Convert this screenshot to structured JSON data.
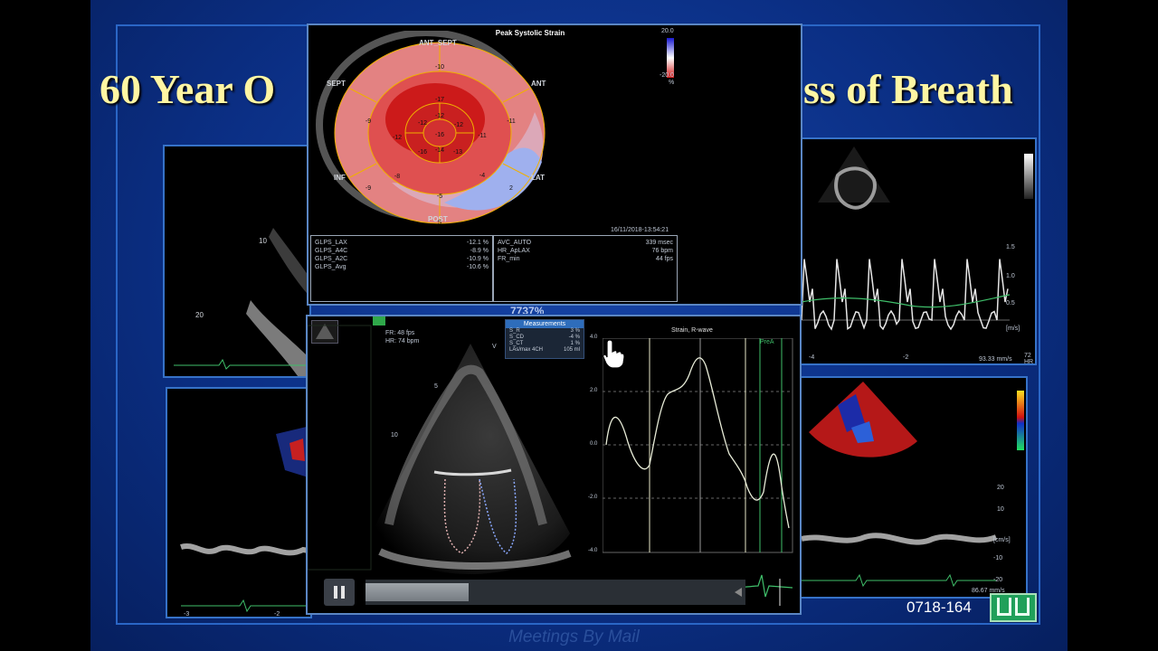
{
  "slide": {
    "title_left": "60 Year O",
    "title_right": "ss of Breath",
    "case_number": "0718-164",
    "watermark": "Meetings By Mail",
    "obscured_value": "7737%"
  },
  "bullseye": {
    "heading": "Peak Systolic Strain",
    "labels": {
      "ant_sept": "ANT_SEPT",
      "ant": "ANT",
      "sept": "SEPT",
      "inf": "INF",
      "lat": "LAT",
      "post": "POST"
    },
    "scale": {
      "max": "20.0",
      "min": "-20.0",
      "unit": "%"
    },
    "timestamp": "16/11/2018-13:54:21",
    "segment_values": [
      "-10",
      "-9",
      "-11",
      "-11",
      "2",
      "5",
      "-5",
      "-9",
      "-12",
      "-17",
      "-12",
      "-8",
      "-16",
      "-13",
      "-4",
      "-12",
      "-16",
      "-12",
      "-14"
    ],
    "stats_left": [
      {
        "label": "GLPS_LAX",
        "value": "-12.1 %"
      },
      {
        "label": "GLPS_A4C",
        "value": "-8.9 %"
      },
      {
        "label": "GLPS_A2C",
        "value": "-10.9 %"
      },
      {
        "label": "GLPS_Avg",
        "value": "-10.6 %"
      }
    ],
    "stats_right": [
      {
        "label": "AVC_AUTO",
        "value": "339 msec"
      },
      {
        "label": "HR_ApLAX",
        "value": "76 bpm"
      },
      {
        "label": "FR_min",
        "value": "44 fps"
      }
    ]
  },
  "echo": {
    "fr": "FR: 48 fps",
    "hr": "HR: 74 bpm",
    "apex_label": "V",
    "depth_marks": [
      "5",
      "10"
    ],
    "measurements": {
      "title": "Measurements",
      "rows": [
        {
          "label": "S_R",
          "value": "3 %"
        },
        {
          "label": "S_CD",
          "value": "-4 %"
        },
        {
          "label": "S_CT",
          "value": "1 %"
        },
        {
          "label": "LAs/max 4CH",
          "value": "105 ml"
        }
      ]
    }
  },
  "strain_plot": {
    "title": "Strain, R-wave",
    "marker": "PreA",
    "y_ticks": [
      "4.0",
      "2.0",
      "0.0",
      "-2.0",
      "-4.0"
    ]
  },
  "doppler_top": {
    "ticks": [
      "1.5",
      "1.0",
      "0.5"
    ],
    "unit": "[m/s]",
    "x_ticks": [
      "-4",
      "-2"
    ],
    "footer": "93.33 mm/s",
    "hr": "72 HR"
  },
  "doppler_bottom": {
    "ticks": [
      "20",
      "10",
      "-10",
      "-20"
    ],
    "unit": "[cm/s]",
    "footer": "86.67 mm/s",
    "hr": "72 HR"
  },
  "left_top_panel": {
    "depth_marks": [
      "10",
      "20"
    ]
  },
  "left_bottom_panel": {
    "x_ticks": [
      "-3",
      "-2"
    ]
  },
  "icons": {
    "pause": "pause-icon",
    "cursor": "hand-pointer-icon",
    "logo": "meetings-logo-icon",
    "thumbnail": "loop-thumbnail-icon"
  },
  "colors": {
    "slide_bg": "#0b2f85",
    "title": "#fff6a3",
    "panel_border": "#3672c8",
    "strain_negative": "#e02020",
    "strain_positive": "#8fa0e8",
    "trace": "#e8ecd8",
    "ecg": "#3fbf6a"
  }
}
